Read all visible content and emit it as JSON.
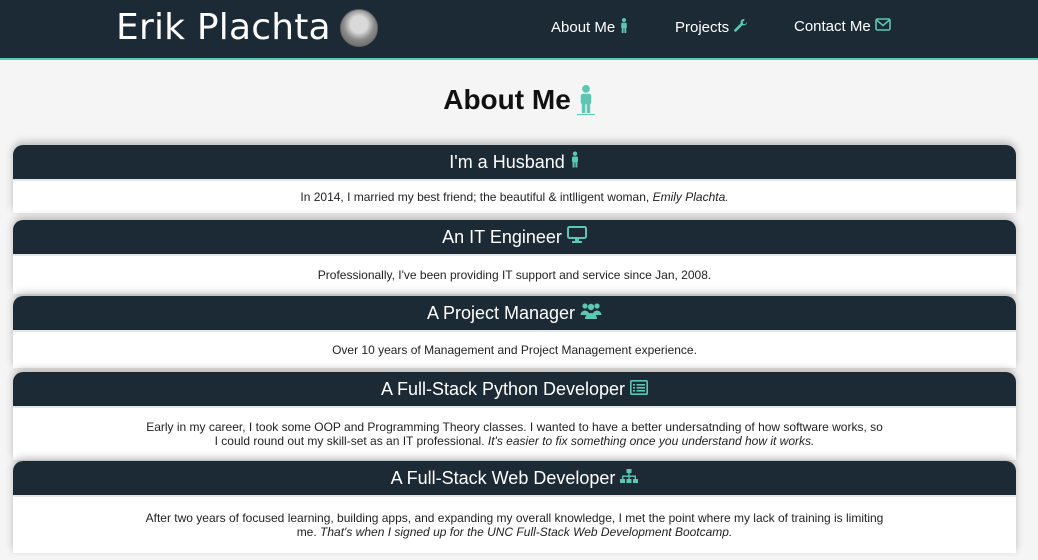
{
  "nav": {
    "brand": "Erik Plachta",
    "links": [
      {
        "label": "About Me",
        "icon": "person-icon"
      },
      {
        "label": "Projects",
        "icon": "wrench-icon"
      },
      {
        "label": "Contact Me",
        "icon": "envelope-icon"
      }
    ]
  },
  "page": {
    "title": "About Me",
    "title_icon": "person-icon"
  },
  "cards": [
    {
      "heading": "I'm a Husband",
      "icon": "person-icon",
      "text": "In 2014, I married my best friend; the beautiful & intlligent woman,",
      "emphasis": "Emily Plachta."
    },
    {
      "heading": "An IT Engineer",
      "icon": "monitor-icon",
      "text": "Professionally, I've been providing IT support and service since Jan, 2008.",
      "emphasis": ""
    },
    {
      "heading": "A Project Manager",
      "icon": "users-icon",
      "text": "Over 10 years of Management and Project Management experience.",
      "emphasis": ""
    },
    {
      "heading": "A Full-Stack Python Developer",
      "icon": "list-alt-icon",
      "text": "Early in my career, I took some OOP and Programming Theory classes. I wanted to have a better undersatnding of how software works, so I could round out my skill-set as an IT professional.",
      "emphasis": "It's easier to fix something once you understand how it works."
    },
    {
      "heading": "A Full-Stack Web Developer",
      "icon": "sitemap-icon",
      "text": "After two years of focused learning, building apps, and expanding my overall knowledge, I met the point where my lack of training is limiting me.",
      "emphasis": "That's when I signed up for the UNC Full-Stack Web Development Bootcamp."
    }
  ],
  "colors": {
    "navbar": "#1c2a35",
    "accent": "#5cc7b2",
    "background": "#f5f5f5"
  }
}
